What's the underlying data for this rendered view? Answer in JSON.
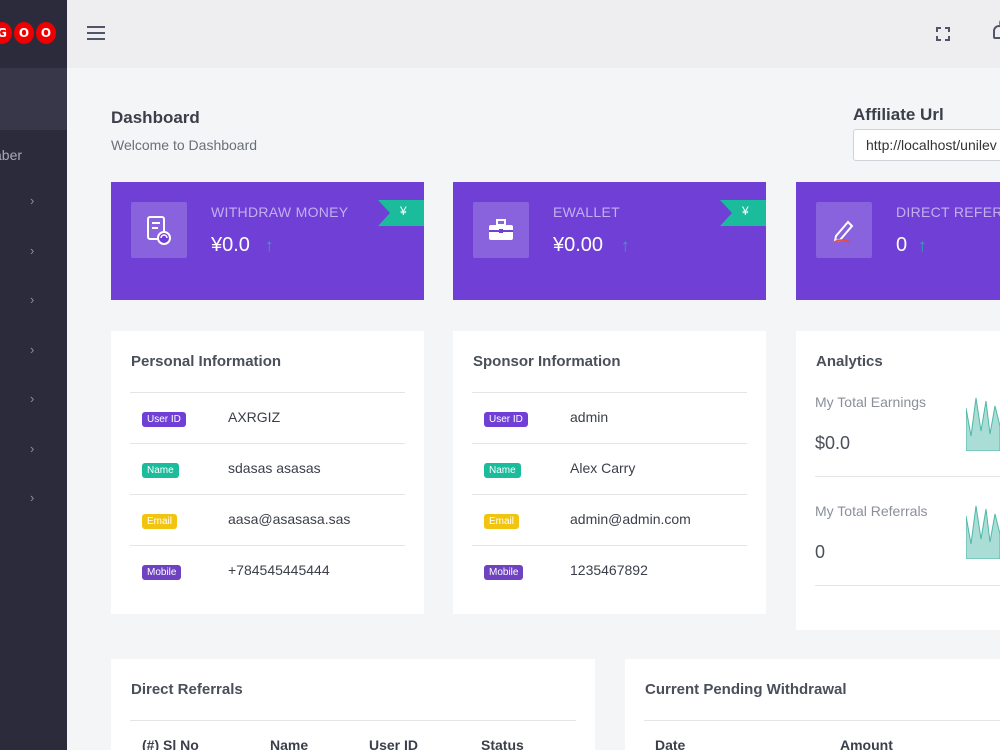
{
  "logo": {
    "letters": [
      "G",
      "O",
      "O"
    ]
  },
  "sidebar": {
    "partial_label": "aber",
    "chevron": "›",
    "chevron_count": 7
  },
  "topbar": {
    "icons": [
      "menu-icon",
      "fullscreen-icon",
      "bell-icon"
    ]
  },
  "header": {
    "title": "Dashboard",
    "subtitle": "Welcome to Dashboard"
  },
  "affiliate": {
    "title": "Affiliate Url",
    "url": "http://localhost/unilev"
  },
  "stats": [
    {
      "label": "WITHDRAW MONEY",
      "value": "¥0.0",
      "ribbon": "¥",
      "arrow": "↑",
      "icon": "withdraw-icon"
    },
    {
      "label": "EWALLET",
      "value": "¥0.00",
      "ribbon": "¥",
      "arrow": "↑",
      "icon": "briefcase-icon"
    },
    {
      "label": "DIRECT REFERR",
      "value": "0",
      "arrow": "↑",
      "icon": "pencil-icon"
    }
  ],
  "personal": {
    "title": "Personal Information",
    "rows": [
      {
        "badge": "User ID",
        "value": "AXRGIZ"
      },
      {
        "badge": "Name",
        "value": "sdasas asasas"
      },
      {
        "badge": "Email",
        "value": "aasa@asasasa.sas"
      },
      {
        "badge": "Mobile",
        "value": "+784545445444"
      }
    ]
  },
  "sponsor": {
    "title": "Sponsor Information",
    "rows": [
      {
        "badge": "User ID",
        "value": "admin"
      },
      {
        "badge": "Name",
        "value": "Alex Carry"
      },
      {
        "badge": "Email",
        "value": "admin@admin.com"
      },
      {
        "badge": "Mobile",
        "value": "1235467892"
      }
    ]
  },
  "badge_colors": {
    "User ID": "#7040d6",
    "Name": "#1abc9c",
    "Email": "#f1c40f",
    "Mobile": "#6f42c1"
  },
  "analytics": {
    "title": "Analytics",
    "earnings_label": "My Total Earnings",
    "earnings_value": "$0.0",
    "referrals_label": "My Total Referrals",
    "referrals_value": "0"
  },
  "direct_referrals": {
    "title": "Direct Referrals",
    "columns": [
      "(#) Sl No",
      "Name",
      "User ID",
      "Status"
    ]
  },
  "pending_withdrawal": {
    "title": "Current Pending Withdrawal",
    "columns": [
      "Date",
      "Amount"
    ]
  },
  "colors": {
    "accent": "#7040d6",
    "teal": "#1abc9c",
    "sidebar": "#2c2b3c"
  }
}
